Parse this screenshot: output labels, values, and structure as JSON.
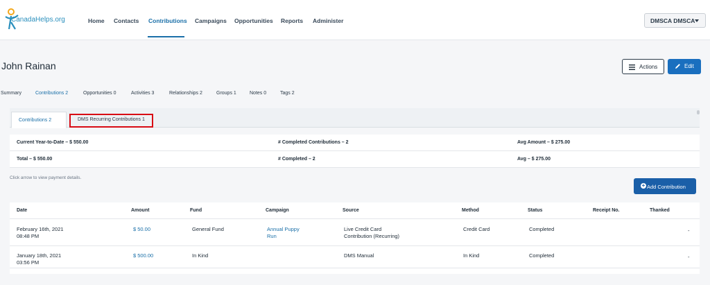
{
  "brand": {
    "logo_text": "CanadaHelps.org"
  },
  "nav": {
    "items": [
      "Home",
      "Contacts",
      "Contributions",
      "Campaigns",
      "Opportunities",
      "Reports",
      "Administer"
    ],
    "active": "Contributions"
  },
  "account": {
    "label": "DMSCA DMSCA"
  },
  "contact": {
    "name": "John Rainan"
  },
  "header_actions": {
    "actions_label": "Actions",
    "edit_label": "Edit"
  },
  "subtabs": [
    "Summary",
    "Contributions 2",
    "Opportunities 0",
    "Activities 3",
    "Relationships 2",
    "Groups 1",
    "Notes 0",
    "Tags 2"
  ],
  "panel_tabs": {
    "contributions": "Contributions 2",
    "recurring": "DMS Recurring Contributions 1"
  },
  "stats": {
    "ytd": "Current Year-to-Date – $ 550.00",
    "completed_contrib": "# Completed Contributions – 2",
    "avg_amount": "Avg Amount – $ 275.00",
    "total": "Total – $ 550.00",
    "completed": "# Completed – 2",
    "avg": "Avg – $ 275.00"
  },
  "hint": "Click arrow to view payment details.",
  "add_button": "Add Contribution",
  "table": {
    "headers": [
      "Date",
      "Amount",
      "Fund",
      "Campaign",
      "Source",
      "Method",
      "Status",
      "Receipt No.",
      "Thanked"
    ],
    "rows": [
      {
        "date": "February 16th, 2021",
        "time": "08:48 PM",
        "amount": "$ 50.00",
        "fund": "General Fund",
        "campaign_l1": "Annual Puppy",
        "campaign_l2": "Run",
        "source_l1": "Live Credit Card",
        "source_l2": "Contribution (Recurring)",
        "method": "Credit Card",
        "status": "Completed",
        "receipt": "",
        "thanked": "-"
      },
      {
        "date": "January 18th, 2021",
        "time": "03:56 PM",
        "amount": "$ 500.00",
        "fund": "In Kind",
        "campaign_l1": "",
        "campaign_l2": "",
        "source_l1": "DMS Manual",
        "source_l2": "",
        "method": "In Kind",
        "status": "Completed",
        "receipt": "",
        "thanked": "-"
      }
    ]
  },
  "colors": {
    "accent": "#1a6fa8",
    "primary_button": "#1a6fbf",
    "highlight": "#d80b14"
  }
}
